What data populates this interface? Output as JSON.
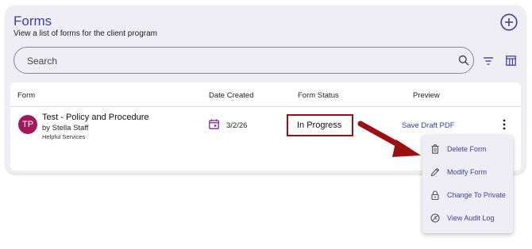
{
  "header": {
    "title": "Forms",
    "subtitle": "View a list of forms for the client program"
  },
  "search": {
    "placeholder": "Search"
  },
  "table": {
    "columns": [
      "Form",
      "Date Created",
      "Form Status",
      "Preview"
    ],
    "rows": [
      {
        "avatar_initials": "TP",
        "form_name": "Test - Policy and Procedure",
        "author": "by Stella Staff",
        "organization": "Helpful Services",
        "date_created": "3/2/26",
        "status": "In Progress",
        "preview_link": "Save Draft PDF"
      }
    ]
  },
  "row_menu": {
    "items": [
      {
        "label": "Delete Form",
        "icon": "trash-icon"
      },
      {
        "label": "Modify Form",
        "icon": "pencil-icon"
      },
      {
        "label": "Change To Private",
        "icon": "lock-icon"
      },
      {
        "label": "View Audit Log",
        "icon": "history-icon"
      }
    ]
  },
  "colors": {
    "brand": "#3f3ea7",
    "avatar": "#a3175c",
    "callout": "#9b0e12",
    "link": "#2f3fa5"
  }
}
